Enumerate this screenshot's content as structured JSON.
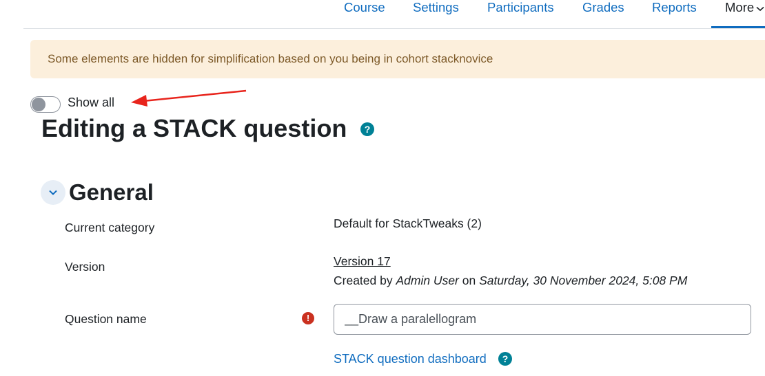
{
  "nav": {
    "items": [
      {
        "label": "Course"
      },
      {
        "label": "Settings"
      },
      {
        "label": "Participants"
      },
      {
        "label": "Grades"
      },
      {
        "label": "Reports"
      }
    ],
    "more_label": "More"
  },
  "alert": {
    "text": "Some elements are hidden for simplification based on you being in cohort stacknovice"
  },
  "toggle": {
    "label": "Show all",
    "checked": false
  },
  "page": {
    "title": "Editing a STACK question",
    "help_glyph": "?"
  },
  "section": {
    "title": "General"
  },
  "form": {
    "current_category": {
      "label": "Current category",
      "value": "Default for StackTweaks (2)"
    },
    "version": {
      "label": "Version",
      "link": "Version 17",
      "created_by_prefix": "Created by ",
      "author": "Admin User",
      "on_text": " on ",
      "date": "Saturday, 30 November 2024, 5:08 PM"
    },
    "question_name": {
      "label": "Question name",
      "value": "__Draw a paralellogram",
      "required_glyph": "!"
    },
    "dashboard_link": "STACK question dashboard"
  },
  "colors": {
    "link": "#0f6cbf",
    "alert_bg": "#fcefdc",
    "alert_text": "#7d5a29",
    "help_icon": "#008196",
    "required_icon": "#ca3120",
    "annotation_arrow": "#e8241c"
  },
  "icons": {
    "more_caret": "chevron-down-icon",
    "section_toggle": "chevron-down-icon",
    "help": "question-circle-icon",
    "required": "exclamation-circle-icon",
    "annotation": "red-arrow-icon"
  }
}
